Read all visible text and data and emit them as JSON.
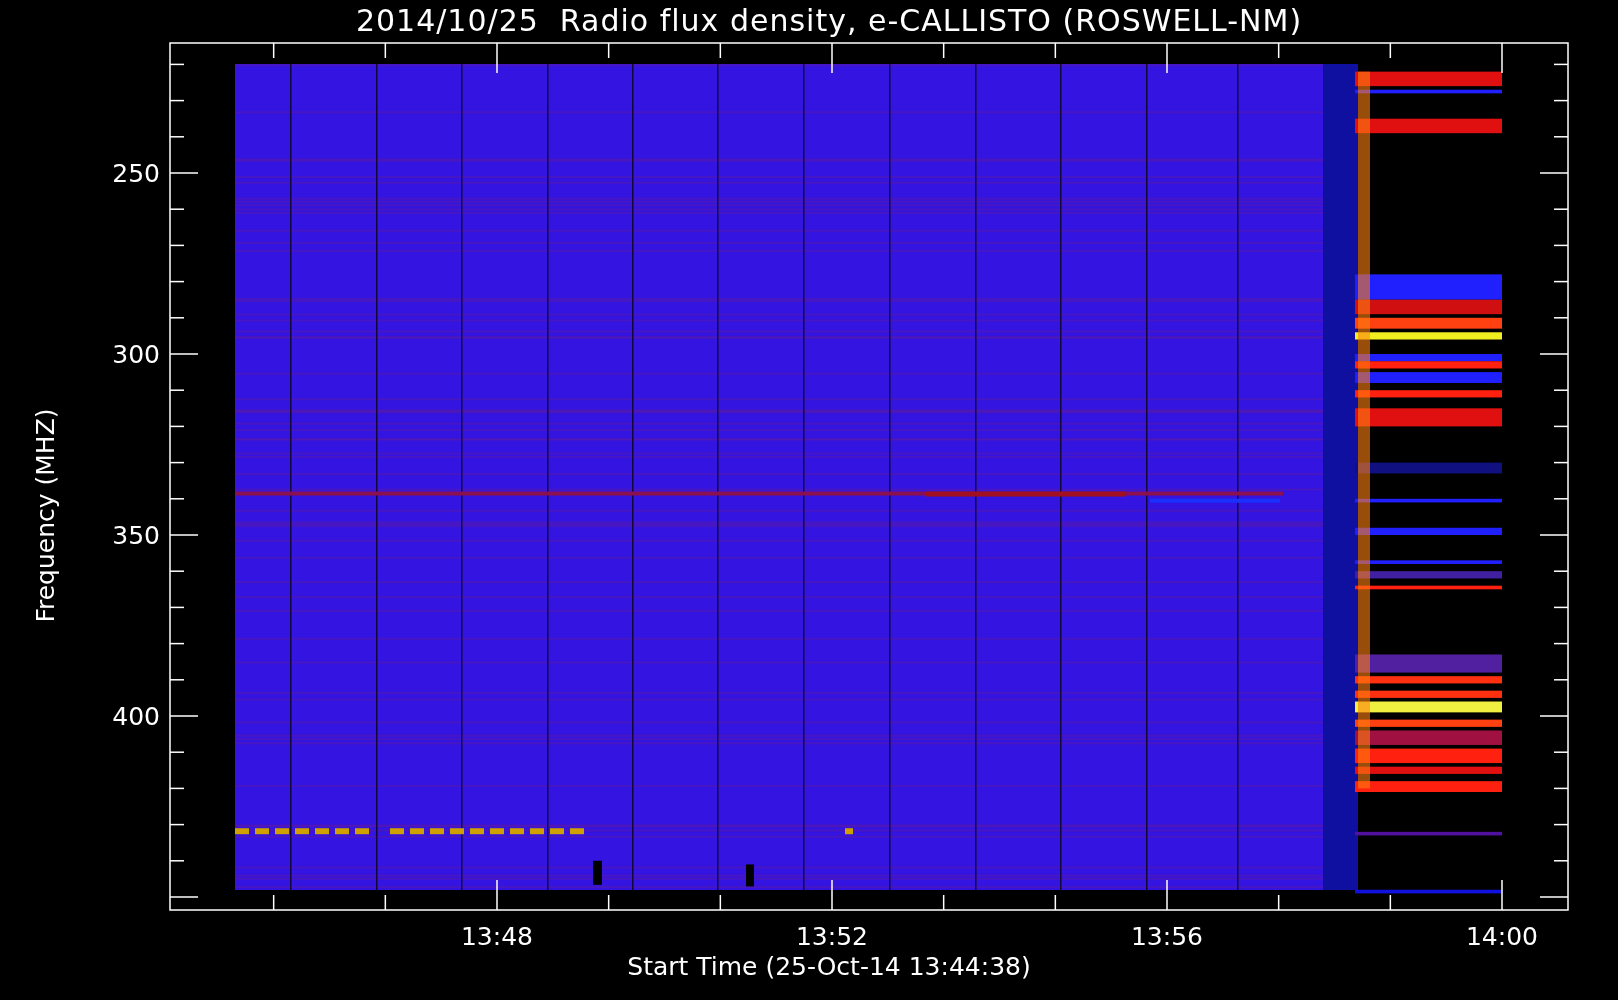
{
  "title": "2014/10/25  Radio flux density, e-CALLISTO (ROSWELL-NM)",
  "y_axis": {
    "title": "Frequency (MHZ)",
    "tick_labels": [
      "250",
      "300",
      "350",
      "400"
    ]
  },
  "x_axis": {
    "title": "Start Time (25-Oct-14 13:44:38)",
    "tick_labels": [
      "13:48",
      "13:52",
      "13:56",
      "14:00"
    ]
  }
}
